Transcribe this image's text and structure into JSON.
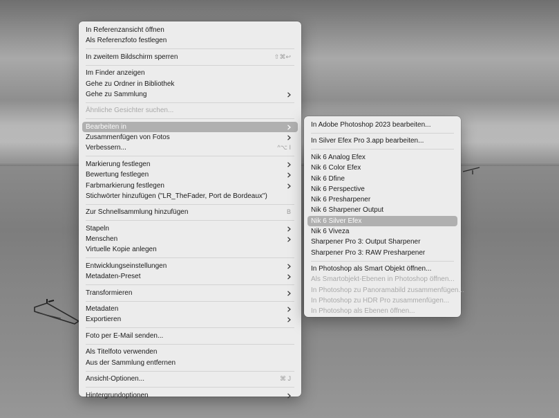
{
  "main_menu": {
    "groups": [
      [
        {
          "label": "In Referenzansicht öffnen"
        },
        {
          "label": "Als Referenzfoto festlegen"
        }
      ],
      [
        {
          "label": "In zweitem Bildschirm sperren",
          "shortcut": "⇧⌘↩"
        }
      ],
      [
        {
          "label": "Im Finder anzeigen"
        },
        {
          "label": "Gehe zu Ordner in Bibliothek"
        },
        {
          "label": "Gehe zu Sammlung",
          "submenu": true
        }
      ],
      [
        {
          "label": "Ähnliche Gesichter suchen...",
          "disabled": true
        }
      ],
      [
        {
          "label": "Bearbeiten in",
          "submenu": true,
          "selected": true
        },
        {
          "label": "Zusammenfügen von Fotos",
          "submenu": true
        },
        {
          "label": "Verbessern...",
          "shortcut": "^⌥ I"
        }
      ],
      [
        {
          "label": "Markierung festlegen",
          "submenu": true
        },
        {
          "label": "Bewertung festlegen",
          "submenu": true
        },
        {
          "label": "Farbmarkierung festlegen",
          "submenu": true
        },
        {
          "label": "Stichwörter hinzufügen (\"LR_TheFader, Port de Bordeaux\")"
        }
      ],
      [
        {
          "label": "Zur Schnellsammlung hinzufügen",
          "shortcut": "B"
        }
      ],
      [
        {
          "label": "Stapeln",
          "submenu": true
        },
        {
          "label": "Menschen",
          "submenu": true
        },
        {
          "label": "Virtuelle Kopie anlegen"
        }
      ],
      [
        {
          "label": "Entwicklungseinstellungen",
          "submenu": true
        },
        {
          "label": "Metadaten-Preset",
          "submenu": true
        }
      ],
      [
        {
          "label": "Transformieren",
          "submenu": true
        }
      ],
      [
        {
          "label": "Metadaten",
          "submenu": true
        },
        {
          "label": "Exportieren",
          "submenu": true
        }
      ],
      [
        {
          "label": "Foto per E-Mail senden..."
        }
      ],
      [
        {
          "label": "Als Titelfoto verwenden"
        },
        {
          "label": "Aus der Sammlung entfernen"
        }
      ],
      [
        {
          "label": "Ansicht-Optionen...",
          "shortcut": "⌘ J"
        }
      ],
      [
        {
          "label": "Hintergrundoptionen",
          "submenu": true
        }
      ]
    ]
  },
  "sub_menu": {
    "groups": [
      [
        {
          "label": "In Adobe Photoshop 2023 bearbeiten..."
        }
      ],
      [
        {
          "label": "In Silver Efex Pro 3.app bearbeiten..."
        }
      ],
      [
        {
          "label": "Nik 6 Analog Efex"
        },
        {
          "label": "Nik 6 Color Efex"
        },
        {
          "label": "Nik 6 Dfine"
        },
        {
          "label": "Nik 6 Perspective"
        },
        {
          "label": "Nik 6 Presharpener"
        },
        {
          "label": "Nik 6 Sharpener Output"
        },
        {
          "label": "Nik 6 Silver Efex",
          "selected": true
        },
        {
          "label": "Nik 6 Viveza"
        },
        {
          "label": "Sharpener Pro 3: Output Sharpener"
        },
        {
          "label": "Sharpener Pro 3: RAW Presharpener"
        }
      ],
      [
        {
          "label": "In Photoshop als Smart Objekt öffnen..."
        },
        {
          "label": "Als Smartobjekt-Ebenen in Photoshop öffnen...",
          "disabled": true
        },
        {
          "label": "In Photoshop zu Panoramabild zusammenfügen...",
          "disabled": true
        },
        {
          "label": "In Photoshop zu HDR Pro zusammenfügen...",
          "disabled": true
        },
        {
          "label": "In Photoshop als Ebenen öffnen...",
          "disabled": true
        }
      ]
    ]
  },
  "colors": {
    "menu_bg": "#ececec",
    "highlight": "#b0b0b0",
    "disabled_text": "#a9a9a9"
  }
}
